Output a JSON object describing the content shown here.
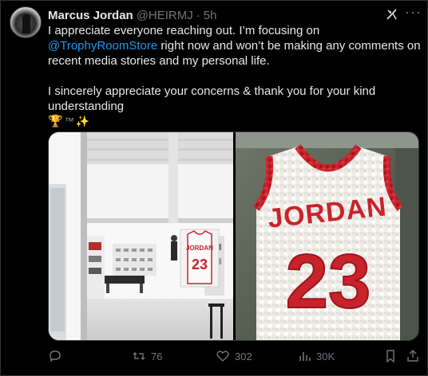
{
  "tweet": {
    "author_name": "Marcus Jordan",
    "handle": "@HEIRMJ",
    "separator": "·",
    "time": "5h",
    "text_line1_a": "I appreciate everyone reaching out. I’m focusing on ",
    "mention": "@TrophyRoomStore",
    "text_line1_b": " right now and won’t be making any comments on recent media stories and my personal life.",
    "text_para2": "I sincerely appreciate your concerns & thank you for your kind understanding",
    "emojis": {
      "trophy": "🏆",
      "tm": "™",
      "sparkles": "✨"
    }
  },
  "media": {
    "left": {
      "jersey_name": "JORDAN",
      "jersey_number": "23",
      "description": "store interior"
    },
    "right": {
      "jersey_name": "JORDAN",
      "jersey_number": "23"
    }
  },
  "actions": {
    "reply_count": "",
    "retweet_count": "76",
    "like_count": "302",
    "views_count": "30K"
  },
  "icons": [
    "grok-icon",
    "more-icon",
    "reply-icon",
    "retweet-icon",
    "like-icon",
    "views-icon",
    "bookmark-icon",
    "share-icon"
  ],
  "colors": {
    "background": "#000000",
    "text": "#e7e9ea",
    "muted": "#71767b",
    "link": "#1d9bf0",
    "jersey_red": "#c8232c"
  }
}
